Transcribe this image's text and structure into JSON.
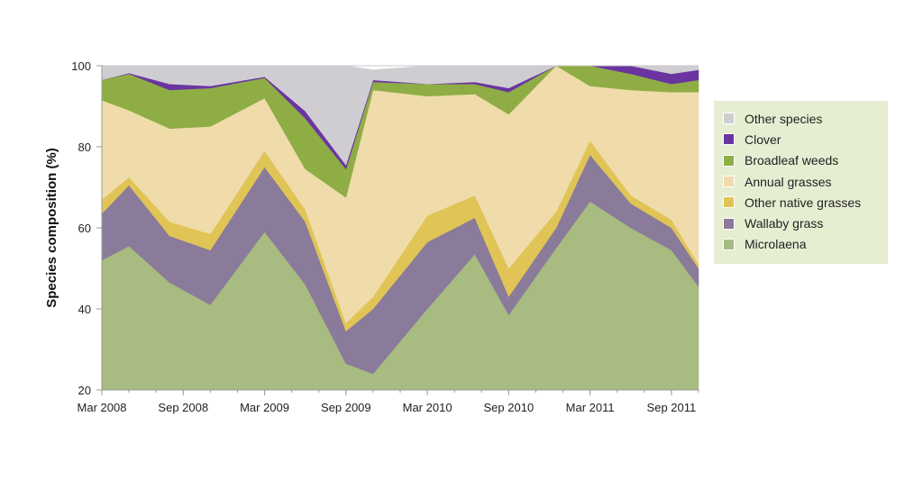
{
  "chart_data": {
    "type": "area",
    "stacked": true,
    "title": "",
    "xlabel": "",
    "ylabel": "Species composition (%)",
    "ylim": [
      20,
      100
    ],
    "yticks": [
      20,
      40,
      60,
      80,
      100
    ],
    "x_months": [
      0,
      2,
      5,
      8,
      12,
      15,
      18,
      20,
      24,
      27.5,
      30,
      33.5,
      36,
      39,
      42,
      44
    ],
    "x_dates": [
      "Mar 2008",
      "May 2008",
      "Aug 2008",
      "Nov 2008",
      "Mar 2009",
      "Jun 2009",
      "Sep 2009",
      "Nov 2009",
      "Mar 2010",
      "Jul 2010",
      "Sep 2010",
      "Jan 2011",
      "Mar 2011",
      "Jun 2011",
      "Sep 2011",
      "Nov 2011"
    ],
    "xticks": [
      {
        "label": "Mar 2008",
        "month": 0
      },
      {
        "label": "Sep 2008",
        "month": 6
      },
      {
        "label": "Mar 2009",
        "month": 12
      },
      {
        "label": "Sep 2009",
        "month": 18
      },
      {
        "label": "Mar 2010",
        "month": 24
      },
      {
        "label": "Sep 2010",
        "month": 30
      },
      {
        "label": "Mar 2011",
        "month": 36
      },
      {
        "label": "Sep 2011",
        "month": 42
      }
    ],
    "minor_tick_every_months": 2,
    "x_range_months": [
      0,
      44
    ],
    "legend_position": "right",
    "series": [
      {
        "name": "Microlaena",
        "color": "#a8bb80",
        "values": [
          52,
          55.5,
          46.5,
          41,
          59,
          46,
          26.5,
          24,
          40,
          53.5,
          38.5,
          55,
          66.5,
          60,
          54.5,
          45.5
        ]
      },
      {
        "name": "Wallaby grass",
        "color": "#8a7b9a",
        "values": [
          11.5,
          15,
          11.5,
          13.5,
          16,
          15.5,
          8,
          16,
          16.5,
          9,
          4.5,
          5,
          11.5,
          6,
          5.5,
          4.5
        ]
      },
      {
        "name": "Other native grasses",
        "color": "#e0c455",
        "values": [
          3.5,
          2,
          3.5,
          4,
          4,
          3,
          2,
          3,
          6.5,
          5.5,
          7,
          4,
          3.5,
          2,
          2,
          1
        ]
      },
      {
        "name": "Annual grasses",
        "color": "#efdcaa",
        "values": [
          24.5,
          16.5,
          23,
          26.5,
          13,
          10,
          31,
          51,
          29.5,
          25,
          38,
          37,
          13.5,
          26,
          31.5,
          42.5
        ]
      },
      {
        "name": "Broadleaf weeds",
        "color": "#8fad45",
        "values": [
          5,
          9,
          9.5,
          9.5,
          5,
          12.5,
          7,
          2,
          3,
          2.5,
          5.5,
          5,
          5,
          4,
          2,
          3
        ]
      },
      {
        "name": "Clover",
        "color": "#6a35a0",
        "values": [
          0,
          0.2,
          1.5,
          0.5,
          0.3,
          1.8,
          1,
          0.5,
          0,
          0.5,
          1,
          1.5,
          1.3,
          2.5,
          2.5,
          2.5
        ]
      },
      {
        "name": "Other species",
        "color": "#cfcdd2",
        "values": [
          3.5,
          1.8,
          4.5,
          5,
          2.7,
          11.2,
          24.5,
          2.5,
          4.5,
          4,
          5.5,
          2.5,
          0,
          0,
          2,
          1
        ]
      }
    ]
  },
  "legend": {
    "items": [
      {
        "label": "Other species",
        "color": "#cfcdd2"
      },
      {
        "label": "Clover",
        "color": "#6a35a0"
      },
      {
        "label": "Broadleaf weeds",
        "color": "#8fad45"
      },
      {
        "label": "Annual grasses",
        "color": "#efdcaa"
      },
      {
        "label": "Other native grasses",
        "color": "#e0c455"
      },
      {
        "label": "Wallaby grass",
        "color": "#8a7b9a"
      },
      {
        "label": "Microlaena",
        "color": "#a8bb80"
      }
    ]
  }
}
